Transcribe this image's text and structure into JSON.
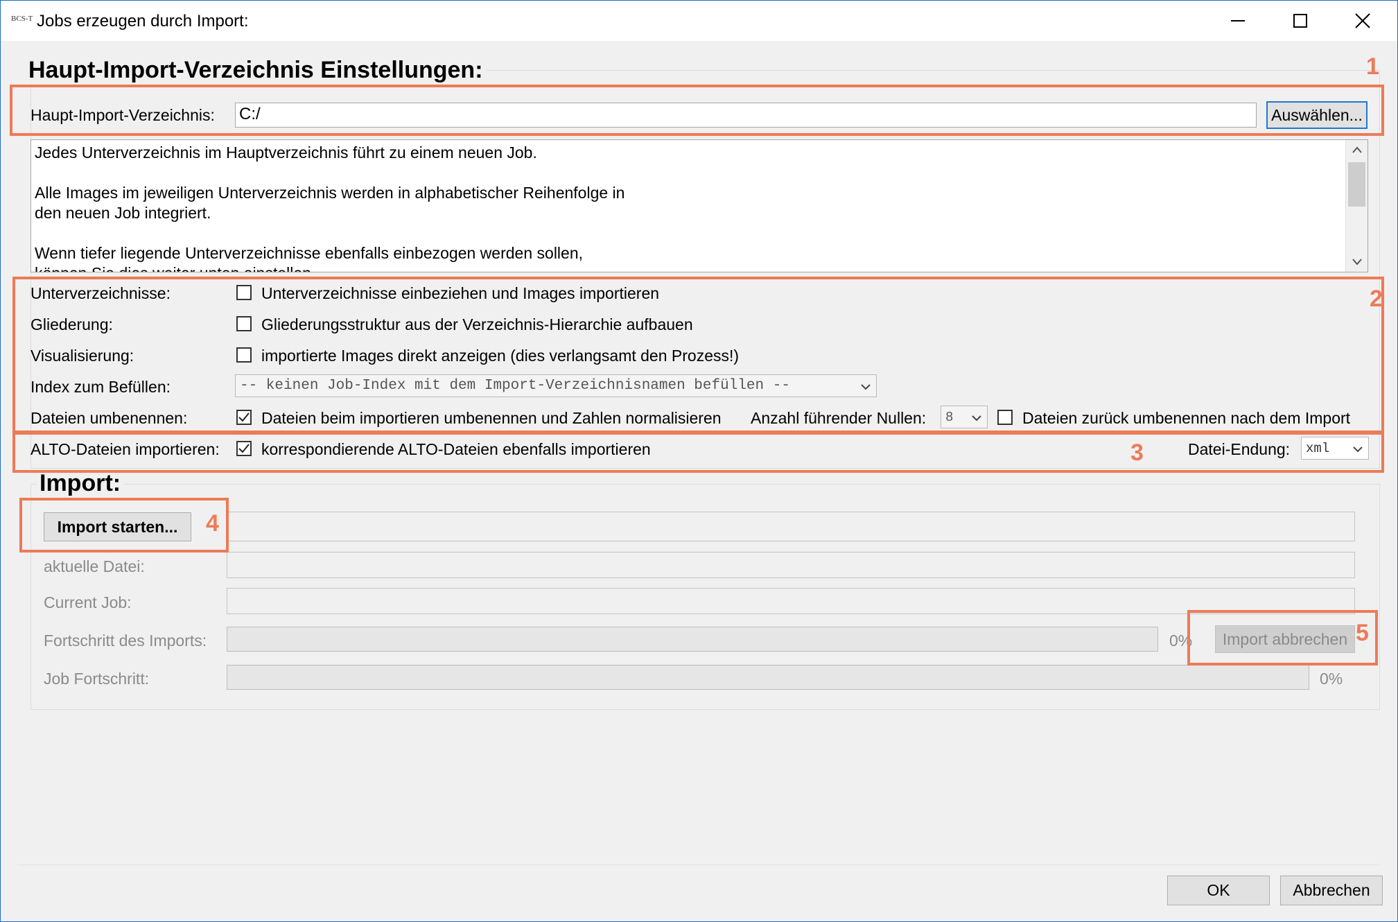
{
  "window": {
    "logo_text": "BCS-T",
    "title": "Jobs erzeugen durch Import:"
  },
  "main_settings": {
    "title": "Haupt-Import-Verzeichnis Einstellungen:",
    "dir_label": "Haupt-Import-Verzeichnis:",
    "dir_value": "C:/",
    "browse_button": "Auswählen...",
    "description_lines": [
      "Jedes Unterverzeichnis im Hauptverzeichnis führt zu einem neuen Job.",
      "",
      "Alle Images im jeweiligen Unterverzeichnis werden in alphabetischer Reihenfolge in",
      "den neuen Job integriert.",
      "",
      "Wenn tiefer liegende Unterverzeichnisse ebenfalls einbezogen werden sollen,",
      "können Sie dies weiter unten einstellen."
    ]
  },
  "options": {
    "subdirs_label": "Unterverzeichnisse:",
    "subdirs_checkbox": "Unterverzeichnisse einbeziehen und Images importieren",
    "subdirs_checked": false,
    "structure_label": "Gliederung:",
    "structure_checkbox": "Gliederungsstruktur aus der Verzeichnis-Hierarchie aufbauen",
    "structure_checked": false,
    "visual_label": "Visualisierung:",
    "visual_checkbox": "importierte Images direkt anzeigen (dies verlangsamt den Prozess!)",
    "visual_checked": false,
    "index_label": "Index zum Befüllen:",
    "index_value": "-- keinen Job-Index mit dem Import-Verzeichnisnamen befüllen --",
    "rename_label": "Dateien umbenennen:",
    "rename_checkbox": "Dateien beim importieren umbenennen und Zahlen normalisieren",
    "rename_checked": true,
    "zeros_label": "Anzahl führender Nullen:",
    "zeros_value": "8",
    "rename_back_checkbox": "Dateien zurück umbenennen nach dem Import",
    "rename_back_checked": false,
    "alto_label": "ALTO-Dateien importieren:",
    "alto_checkbox": "korrespondierende ALTO-Dateien ebenfalls importieren",
    "alto_checked": true,
    "ext_label": "Datei-Endung:",
    "ext_value": "xml"
  },
  "import": {
    "title": "Import:",
    "start_button": "Import starten...",
    "current_file_label": "aktuelle Datei:",
    "current_job_label": "Current Job:",
    "progress_label": "Fortschritt des Imports:",
    "progress_percent": "0%",
    "progress_value": 0,
    "cancel_button": "Import abbrechen",
    "job_progress_label": "Job Fortschritt:",
    "job_progress_percent": "0%",
    "job_progress_value": 0
  },
  "footer": {
    "ok_button": "OK",
    "cancel_button": "Abbrechen"
  },
  "annotations": [
    "1",
    "2",
    "3",
    "4",
    "5"
  ],
  "colors": {
    "annotation": "#ec7b58",
    "focus_border": "#1f78d1"
  }
}
